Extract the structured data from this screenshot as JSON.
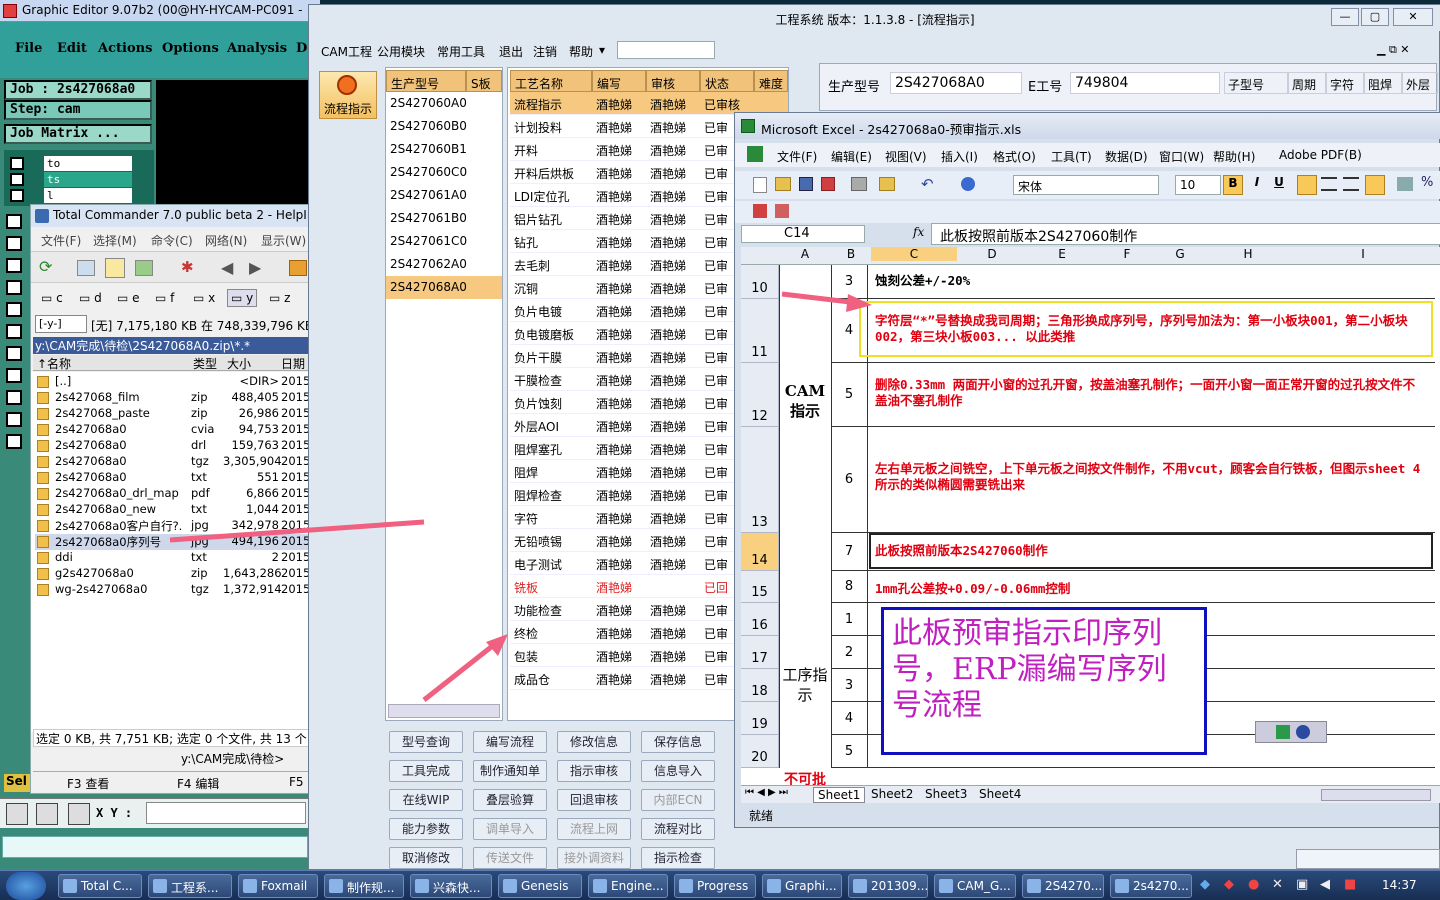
{
  "graphic_editor": {
    "title": "Graphic Editor 9.07b2 (00@HY-HYCAM-PC091 -",
    "menu": [
      "File",
      "Edit",
      "Actions",
      "Options",
      "Analysis",
      "D"
    ],
    "job": "Job : 2s427068a0",
    "step": "Step: cam",
    "job_matrix": "Job Matrix ...",
    "layers": [
      "to",
      "ts",
      "l"
    ],
    "xy_label": "X Y :",
    "sel_label": "Sel"
  },
  "total_commander": {
    "title": "Total Commander 7.0 public beta 2 - HelpIn",
    "menu": [
      "文件(F)",
      "选择(M)",
      "命令(C)",
      "网络(N)",
      "显示(W)"
    ],
    "drives": [
      "c",
      "d",
      "e",
      "f",
      "x",
      "y",
      "z"
    ],
    "drive_select": "[-y-]",
    "free_space": "[无]  7,175,180 KB 在 748,339,796 KB",
    "path": "y:\\CAM完成\\待检\\2S427068A0.zip\\*.*",
    "col_headers": [
      "↑名称",
      "类型",
      "大小",
      "日期"
    ],
    "files": [
      {
        "name": "[..]",
        "type": "",
        "size": "<DIR>",
        "date": "2015"
      },
      {
        "name": "2s427068_film",
        "type": "zip",
        "size": "488,405",
        "date": "2015"
      },
      {
        "name": "2s427068_paste",
        "type": "zip",
        "size": "26,986",
        "date": "2015"
      },
      {
        "name": "2s427068a0",
        "type": "cvia",
        "size": "94,753",
        "date": "2015"
      },
      {
        "name": "2s427068a0",
        "type": "drl",
        "size": "159,763",
        "date": "2015"
      },
      {
        "name": "2s427068a0",
        "type": "tgz",
        "size": "3,305,904",
        "date": "2015"
      },
      {
        "name": "2s427068a0",
        "type": "txt",
        "size": "551",
        "date": "2015"
      },
      {
        "name": "2s427068a0_drl_map",
        "type": "pdf",
        "size": "6,866",
        "date": "2015"
      },
      {
        "name": "2s427068a0_new",
        "type": "txt",
        "size": "1,044",
        "date": "2015"
      },
      {
        "name": "2s427068a0客户自行?.",
        "type": "jpg",
        "size": "342,978",
        "date": "2015"
      },
      {
        "name": "2s427068a0序列号",
        "type": "jpg",
        "size": "494,196",
        "date": "2015"
      },
      {
        "name": "ddi",
        "type": "txt",
        "size": "2",
        "date": "2015"
      },
      {
        "name": "g2s427068a0",
        "type": "zip",
        "size": "1,643,286",
        "date": "2015"
      },
      {
        "name": "wg-2s427068a0",
        "type": "tgz",
        "size": "1,372,914",
        "date": "2015"
      }
    ],
    "status": "选定 0 KB, 共 7,751 KB; 选定 0 个文件, 共 13 个",
    "cmd_path": "y:\\CAM完成\\待检>",
    "fkeys": [
      "F3 查看",
      "F4 编辑",
      "F5"
    ]
  },
  "eng_system": {
    "title": "工程系统   版本：1.1.3.8 - [流程指示]",
    "menu": [
      "CAM工程",
      "公用模块",
      "常用工具",
      "退出",
      "注销",
      "帮助"
    ],
    "side_button": "流程指示",
    "model_header": [
      "生产型号",
      "S板"
    ],
    "models": [
      "2S427060A0",
      "2S427060B0",
      "2S427060B1",
      "2S427060C0",
      "2S427061A0",
      "2S427061B0",
      "2S427061C0",
      "2S427062A0",
      "2S427068A0"
    ],
    "proc_headers": [
      "工艺名称",
      "编写",
      "审核",
      "状态",
      "难度"
    ],
    "processes": [
      {
        "name": "流程指示",
        "writer": "酒艳娣",
        "checker": "酒艳娣",
        "status": "已审核"
      },
      {
        "name": "计划投料",
        "writer": "酒艳娣",
        "checker": "酒艳娣",
        "status": "已审"
      },
      {
        "name": "开料",
        "writer": "酒艳娣",
        "checker": "酒艳娣",
        "status": "已审"
      },
      {
        "name": "开料后烘板",
        "writer": "酒艳娣",
        "checker": "酒艳娣",
        "status": "已审"
      },
      {
        "name": "LDI定位孔",
        "writer": "酒艳娣",
        "checker": "酒艳娣",
        "status": "已审"
      },
      {
        "name": "铝片钻孔",
        "writer": "酒艳娣",
        "checker": "酒艳娣",
        "status": "已审"
      },
      {
        "name": "钻孔",
        "writer": "酒艳娣",
        "checker": "酒艳娣",
        "status": "已审"
      },
      {
        "name": "去毛刺",
        "writer": "酒艳娣",
        "checker": "酒艳娣",
        "status": "已审"
      },
      {
        "name": "沉铜",
        "writer": "酒艳娣",
        "checker": "酒艳娣",
        "status": "已审"
      },
      {
        "name": "负片电镀",
        "writer": "酒艳娣",
        "checker": "酒艳娣",
        "status": "已审"
      },
      {
        "name": "负电镀磨板",
        "writer": "酒艳娣",
        "checker": "酒艳娣",
        "status": "已审"
      },
      {
        "name": "负片干膜",
        "writer": "酒艳娣",
        "checker": "酒艳娣",
        "status": "已审"
      },
      {
        "name": "干膜检查",
        "writer": "酒艳娣",
        "checker": "酒艳娣",
        "status": "已审"
      },
      {
        "name": "负片蚀刻",
        "writer": "酒艳娣",
        "checker": "酒艳娣",
        "status": "已审"
      },
      {
        "name": "外层AOI",
        "writer": "酒艳娣",
        "checker": "酒艳娣",
        "status": "已审"
      },
      {
        "name": "阻焊塞孔",
        "writer": "酒艳娣",
        "checker": "酒艳娣",
        "status": "已审"
      },
      {
        "name": "阻焊",
        "writer": "酒艳娣",
        "checker": "酒艳娣",
        "status": "已审"
      },
      {
        "name": "阻焊检查",
        "writer": "酒艳娣",
        "checker": "酒艳娣",
        "status": "已审"
      },
      {
        "name": "字符",
        "writer": "酒艳娣",
        "checker": "酒艳娣",
        "status": "已审"
      },
      {
        "name": "无铅喷锡",
        "writer": "酒艳娣",
        "checker": "酒艳娣",
        "status": "已审"
      },
      {
        "name": "电子测试",
        "writer": "酒艳娣",
        "checker": "酒艳娣",
        "status": "已审"
      },
      {
        "name": "铣板",
        "writer": "酒艳娣",
        "checker": "",
        "status": "已回"
      },
      {
        "name": "功能检查",
        "writer": "酒艳娣",
        "checker": "酒艳娣",
        "status": "已审"
      },
      {
        "name": "终检",
        "writer": "酒艳娣",
        "checker": "酒艳娣",
        "status": "已审"
      },
      {
        "name": "包装",
        "writer": "酒艳娣",
        "checker": "酒艳娣",
        "status": "已审"
      },
      {
        "name": "成品仓",
        "writer": "酒艳娣",
        "checker": "酒艳娣",
        "status": "已审"
      }
    ],
    "info_labels": {
      "model": "生产型号",
      "model_value": "2S427068A0",
      "eid": "E工号",
      "eid_value": "749804"
    },
    "right_headers": [
      "子型号",
      "周期",
      "字符",
      "阻焊",
      "外层"
    ],
    "buttons": [
      [
        "型号查询",
        "编写流程",
        "修改信息",
        "保存信息"
      ],
      [
        "工具完成",
        "制作通知单",
        "指示审核",
        "信息导入"
      ],
      [
        "在线WIP",
        "叠层验算",
        "回退审核",
        "内部ECN"
      ],
      [
        "能力参数",
        "调单导入",
        "流程上网",
        "流程对比"
      ],
      [
        "取消修改",
        "传送文件",
        "接外调资料",
        "指示检查"
      ]
    ]
  },
  "excel": {
    "title": "Microsoft Excel - 2s427068a0-预审指示.xls",
    "menu": [
      "文件(F)",
      "编辑(E)",
      "视图(V)",
      "插入(I)",
      "格式(O)",
      "工具(T)",
      "数据(D)",
      "窗口(W)",
      "帮助(H)",
      "Adobe PDF(B)"
    ],
    "font_name": "宋体",
    "font_size": "10",
    "name_box": "C14",
    "formula": "此板按照前版本2S427060制作",
    "columns": [
      "A",
      "B",
      "C",
      "D",
      "E",
      "F",
      "G",
      "H",
      "I"
    ],
    "rows": [
      {
        "row": "10",
        "num": "3",
        "text": "蚀刻公差+/-20%"
      },
      {
        "row": "11",
        "num": "4",
        "text": "字符层“*”号替换成我司周期；三角形换成序列号，序列号加法为：第一小板块001，第二小板块002，第三块小板003...   以此类推"
      },
      {
        "row": "12",
        "num": "5",
        "text": "删除0.33mm 两面开小窗的过孔开窗，按盖油塞孔制作；一面开小窗一面正常开窗的过孔按文件不盖油不塞孔制作"
      },
      {
        "row": "13",
        "num": "6",
        "text": "左右单元板之间铣空，上下单元板之间按文件制作，不用vcut，顾客会自行铁板，但图示sheet 4 所示的类似椭圆需要铣出来"
      },
      {
        "row": "14",
        "num": "7",
        "text": "此板按照前版本2S427060制作"
      },
      {
        "row": "15",
        "num": "8",
        "text": "1mm孔公差按+0.09/-0.06mm控制"
      },
      {
        "row": "16",
        "num": "1",
        "text": ""
      },
      {
        "row": "17",
        "num": "2",
        "text": ""
      },
      {
        "row": "18",
        "num": "3",
        "text": ""
      },
      {
        "row": "19",
        "num": "4",
        "text": ""
      },
      {
        "row": "20",
        "num": "5",
        "text": ""
      }
    ],
    "group_labels": {
      "cam": "CAM指示",
      "process": "工序指示",
      "forbid": "不可批"
    },
    "note": "此板预审指示印序列号，ERP漏编写序列号流程",
    "sheets": [
      "Sheet1",
      "Sheet2",
      "Sheet3",
      "Sheet4"
    ],
    "status": "就绪"
  },
  "taskbar": {
    "items": [
      "Total C...",
      "工程系...",
      "Foxmail",
      "制作规...",
      "兴森快...",
      "Genesis",
      "Engine...",
      "Progress",
      "Graphi...",
      "201309...",
      "CAM_G...",
      "2S4270...",
      "2s4270..."
    ],
    "clock": "14:37"
  },
  "colors": {
    "accent_orange": "#f1c27a",
    "excel_red": "#e00010",
    "note_blue": "#1010c0",
    "note_purple": "#c020c0",
    "arrow": "#f06080"
  }
}
